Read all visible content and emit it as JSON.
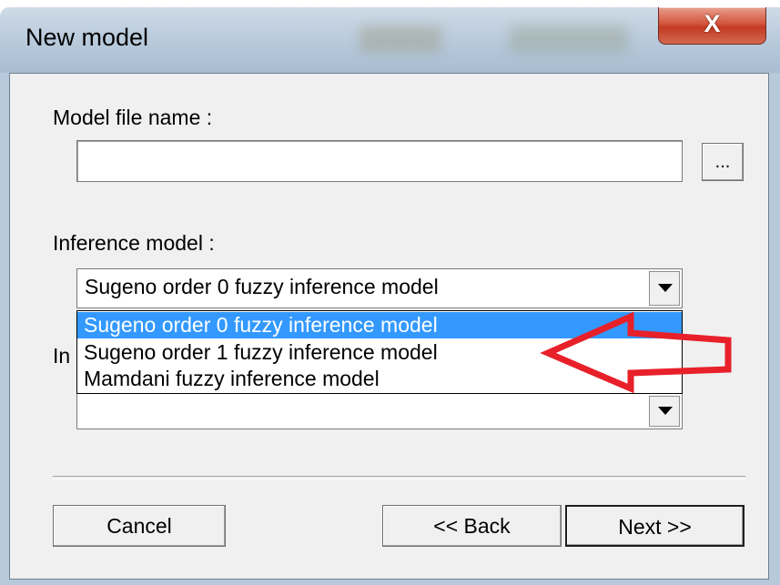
{
  "window": {
    "title": "New model",
    "close_symbol": "X"
  },
  "form": {
    "model_file_label": "Model file name :",
    "model_file_value": "",
    "browse_label": "...",
    "inference_label": "Inference model :",
    "inference_selected": "Sugeno order 0 fuzzy inference model",
    "inference_options": [
      "Sugeno order 0 fuzzy inference model",
      "Sugeno order 1 fuzzy inference model",
      "Mamdani fuzzy inference model"
    ],
    "second_label_partial": "In",
    "second_combo_value": ""
  },
  "buttons": {
    "cancel": "Cancel",
    "back": "<< Back",
    "next": "Next >>"
  },
  "annotation": {
    "icon": "red-arrow-outline-icon",
    "color": "#e8202a"
  },
  "colors": {
    "selection": "#3399ff",
    "dialog_bg": "#f0f0f0",
    "titlebar": "#b7c9db"
  }
}
